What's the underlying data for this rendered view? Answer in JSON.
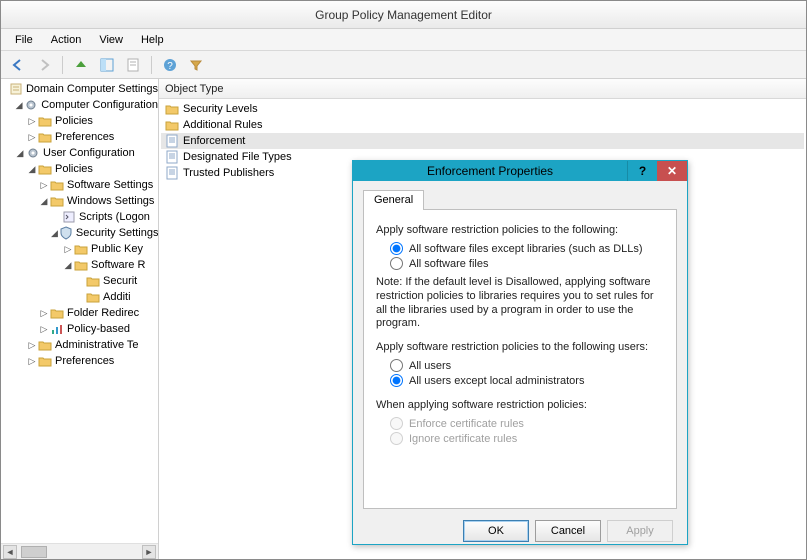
{
  "window": {
    "title": "Group Policy Management Editor"
  },
  "menu": {
    "file": "File",
    "action": "Action",
    "view": "View",
    "help": "Help"
  },
  "list": {
    "header": "Object Type",
    "rows": [
      {
        "icon": "folder",
        "label": "Security Levels"
      },
      {
        "icon": "folder",
        "label": "Additional Rules"
      },
      {
        "icon": "doc",
        "label": "Enforcement",
        "selected": true
      },
      {
        "icon": "doc",
        "label": "Designated File Types"
      },
      {
        "icon": "doc",
        "label": "Trusted Publishers"
      }
    ]
  },
  "tree": [
    {
      "indent": 0,
      "toggle": "",
      "icon": "scroll",
      "label": "Domain Computer Settings"
    },
    {
      "indent": 1,
      "toggle": "open",
      "icon": "gear",
      "label": "Computer Configuration"
    },
    {
      "indent": 2,
      "toggle": "closed",
      "icon": "folder",
      "label": "Policies"
    },
    {
      "indent": 2,
      "toggle": "closed",
      "icon": "folder",
      "label": "Preferences"
    },
    {
      "indent": 1,
      "toggle": "open",
      "icon": "gear",
      "label": "User Configuration"
    },
    {
      "indent": 2,
      "toggle": "open",
      "icon": "folder",
      "label": "Policies"
    },
    {
      "indent": 3,
      "toggle": "closed",
      "icon": "folder",
      "label": "Software Settings"
    },
    {
      "indent": 3,
      "toggle": "open",
      "icon": "folder",
      "label": "Windows Settings"
    },
    {
      "indent": 4,
      "toggle": "",
      "icon": "script",
      "label": "Scripts (Logon"
    },
    {
      "indent": 4,
      "toggle": "open",
      "icon": "shield",
      "label": "Security Settings"
    },
    {
      "indent": 5,
      "toggle": "closed",
      "icon": "folder",
      "label": "Public Key"
    },
    {
      "indent": 5,
      "toggle": "open",
      "icon": "folder",
      "label": "Software R"
    },
    {
      "indent": 6,
      "toggle": "",
      "icon": "folder",
      "label": "Securit"
    },
    {
      "indent": 6,
      "toggle": "",
      "icon": "folder",
      "label": "Additi"
    },
    {
      "indent": 3,
      "toggle": "closed",
      "icon": "folder",
      "label": "Folder Redirec"
    },
    {
      "indent": 3,
      "toggle": "closed",
      "icon": "bars",
      "label": "Policy-based"
    },
    {
      "indent": 2,
      "toggle": "closed",
      "icon": "folder",
      "label": "Administrative Te"
    },
    {
      "indent": 2,
      "toggle": "closed",
      "icon": "folder",
      "label": "Preferences"
    }
  ],
  "dialog": {
    "title": "Enforcement Properties",
    "tab": "General",
    "sec1_label": "Apply software restriction policies to the following:",
    "sec1_opt1": "All software files except libraries (such as DLLs)",
    "sec1_opt2": "All software files",
    "sec1_selected": 0,
    "note": "Note:  If the default level is Disallowed, applying software restriction policies to libraries requires you to set rules for all the libraries used by a program in order to use the program.",
    "sec2_label": "Apply software restriction policies to the following users:",
    "sec2_opt1": "All users",
    "sec2_opt2": "All users except local administrators",
    "sec2_selected": 1,
    "sec3_label": "When applying software restriction policies:",
    "sec3_opt1": "Enforce certificate rules",
    "sec3_opt2": "Ignore certificate rules",
    "buttons": {
      "ok": "OK",
      "cancel": "Cancel",
      "apply": "Apply"
    }
  }
}
